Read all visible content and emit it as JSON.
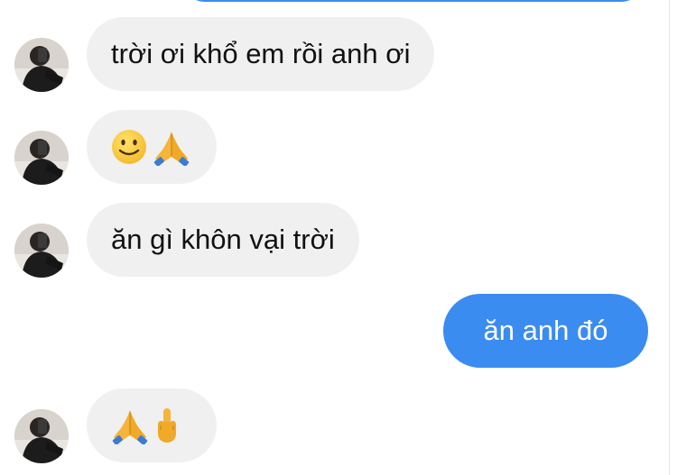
{
  "messages": [
    {
      "direction": "incoming",
      "text": "trời ơi khổ em rồi anh ơi"
    },
    {
      "direction": "incoming",
      "emoji": [
        "slightly-smiling-face",
        "folded-hands"
      ]
    },
    {
      "direction": "incoming",
      "text": "ăn gì khôn vại trời"
    },
    {
      "direction": "outgoing",
      "text": "ăn anh đó"
    },
    {
      "direction": "incoming",
      "emoji": [
        "folded-hands",
        "middle-finger"
      ]
    }
  ],
  "colors": {
    "incoming_bubble": "#f0f0f0",
    "outgoing_bubble": "#3b8cf0",
    "incoming_text": "#111111",
    "outgoing_text": "#ffffff"
  }
}
